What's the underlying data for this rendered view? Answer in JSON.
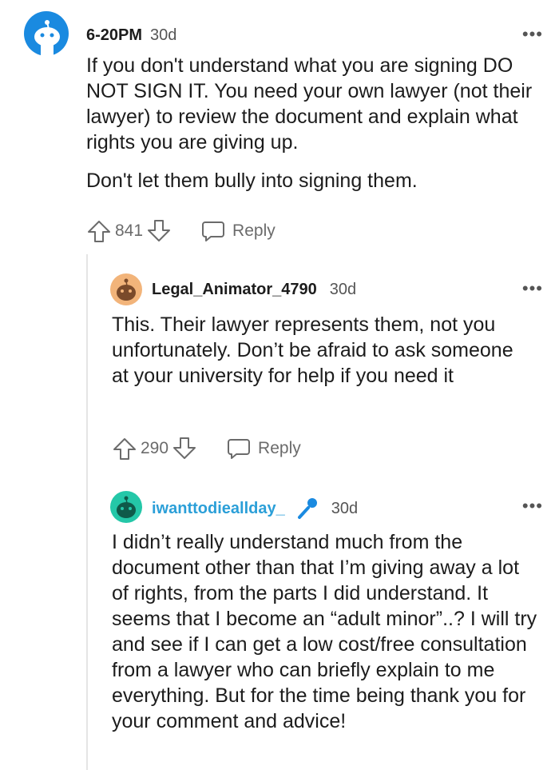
{
  "comments": [
    {
      "username": "6-20PM",
      "time": "30d",
      "body": [
        "If you don't understand what you are signing DO NOT SIGN IT. You need your own lawyer (not their lawyer) to review the document and explain what rights you are giving up.",
        "Don't let them bully into signing them."
      ],
      "score": "841",
      "reply_label": "Reply",
      "more_label": "•••"
    },
    {
      "username": "Legal_Animator_4790",
      "time": "30d",
      "body": [
        "This. Their lawyer represents them, not you unfortunately. Don’t be afraid to ask someone at your university for help if you need it"
      ],
      "score": "290",
      "reply_label": "Reply",
      "more_label": "•••"
    },
    {
      "username": "iwanttodieallday_",
      "time": "30d",
      "body": [
        "I didn’t really understand much from the document other than that I’m giving away a lot of rights, from the parts I did understand. It seems that I become an “adult minor”..? I will try and see if I can get a low cost/free consultation from a lawyer who can briefly explain to me everything. But for the time being thank you for your comment and advice!"
      ],
      "more_label": "•••"
    }
  ],
  "colors": {
    "avatar_blue": "#1a8ae0",
    "avatar_orange": "#f2b47a",
    "avatar_teal": "#24c7a8",
    "op_username": "#2b9fd8",
    "mic_blue": "#1a8ae0"
  },
  "icons": [
    "snoo-avatar-icon",
    "upvote-icon",
    "downvote-icon",
    "reply-icon",
    "more-options-icon",
    "microphone-icon"
  ]
}
